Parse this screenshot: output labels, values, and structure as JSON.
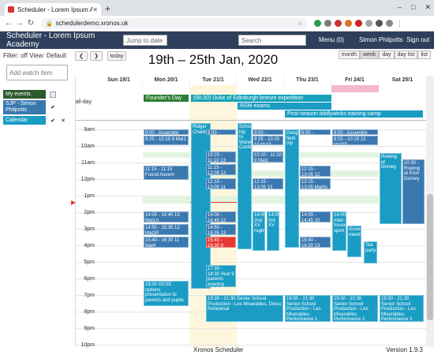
{
  "browser": {
    "tab_title": "Scheduler - Lorem Ipsum A",
    "url": "schedulerdemo.xronos.uk",
    "new_tab": "+"
  },
  "app": {
    "title": "Scheduler - Lorem Ipsum Academy",
    "jump_placeholder": "Jump to date",
    "search_placeholder": "Search",
    "menu_label": "Menu (0)",
    "user_name": "Simon Philpotts",
    "signout_label": "Sign out"
  },
  "subbar": {
    "filter": "Filter: off  View: Default",
    "prev": "❮",
    "next": "❯",
    "today": "today",
    "title": "19th – 25th Jan, 2020",
    "views": [
      "month",
      "week",
      "day",
      "day list",
      "list"
    ]
  },
  "sidebar": {
    "watch_placeholder": "Add watch item",
    "rows": [
      {
        "label": "My events",
        "color": "#2e5a2e",
        "checked": "",
        "del": ""
      },
      {
        "label": "SJP - Simon Philpotts",
        "color": "#3a78b0",
        "checked": "✔",
        "del": ""
      },
      {
        "label": "Calendar",
        "color": "#1a9cc4",
        "checked": "✔",
        "del": "✕"
      }
    ]
  },
  "calendar": {
    "days": [
      "Sun 19/1",
      "Mon 20/1",
      "Tue 21/1",
      "Wed 22/1",
      "Thu 23/1",
      "Fri 24/1",
      "Sat 25/1"
    ],
    "allday_label": "all-day",
    "hours": [
      "9am",
      "10am",
      "11am",
      "12pm",
      "1pm",
      "2pm",
      "3pm",
      "4pm",
      "5pm",
      "6pm",
      "7pm",
      "8pm",
      "9pm",
      "10pm"
    ],
    "allday_events": [
      "Founder's Day",
      "(08:30) Duke of Edinburgh bronze expedition",
      "RSM exams",
      "Post-season tiddlywinks training camp"
    ],
    "events": [
      "9:00 - Assembly",
      "9:25 - 10:15 9 Mat1",
      "11:15 - 11:15 Found Assem",
      "14:00 - 14:45 13 Mat1A",
      "14:50 - 15:35 12 Mat3P",
      "15:40 - 16:30 11 Mat4",
      "18:30 GCSE options presentation to parents and pupils",
      "Ridger Challe",
      "9:00 - Assembly",
      "10:20 - 11:10 13 Mat1A",
      "11:15 - 12:05 12 Mat3P",
      "12:15 - 13:05 11 Mat4",
      "14:00 - 14:45 12 Mat3P",
      "14:50 - 15:35 13 Mat1A",
      "15:40 - 16:30 8 Fre2",
      "17:30 - 18:30 Year 9 parents evening",
      "19:30 - 21:30 Senior School Production - Les Miserables. Dress Rehearsal",
      "School trip to Warwick Castle",
      "9:00 - Assembly",
      "9:25 - 10:15 10 Mat3",
      "10:20 - 11:10 9 Mat1",
      "12:15 - 13:05 13 Mat1A",
      "14:00 2nd XV rugby",
      "14:00 3rd XV",
      "19:30 - 21:30 Senior School Production - Les Miserables. Performance 1",
      "Geography field trip",
      "9:00 - Assembly",
      "12:15 - 13:05 12 Mat3P",
      "12:15 - 13:05 Maths dept",
      "14:00 - 14:45 10 Mat3",
      "15:40 - 16:30 13 Mat1A",
      "19:30 - 21:30 Senior School Production - Les Miserables. Performance 2",
      "9:00 - Assembly",
      "9:25 - 10:15 13 Mat3P",
      "14:00 Inter-house sport",
      "Governors meeting",
      "Tea party",
      "19:30 - 21:30 Senior School Production - Les Miserables. Performance 3",
      "Rowing at Dorney",
      "10:30 - Rowing at Eton Dorney"
    ]
  },
  "footer": {
    "center": "Xronos Scheduler",
    "version": "Version 1.9.3"
  }
}
